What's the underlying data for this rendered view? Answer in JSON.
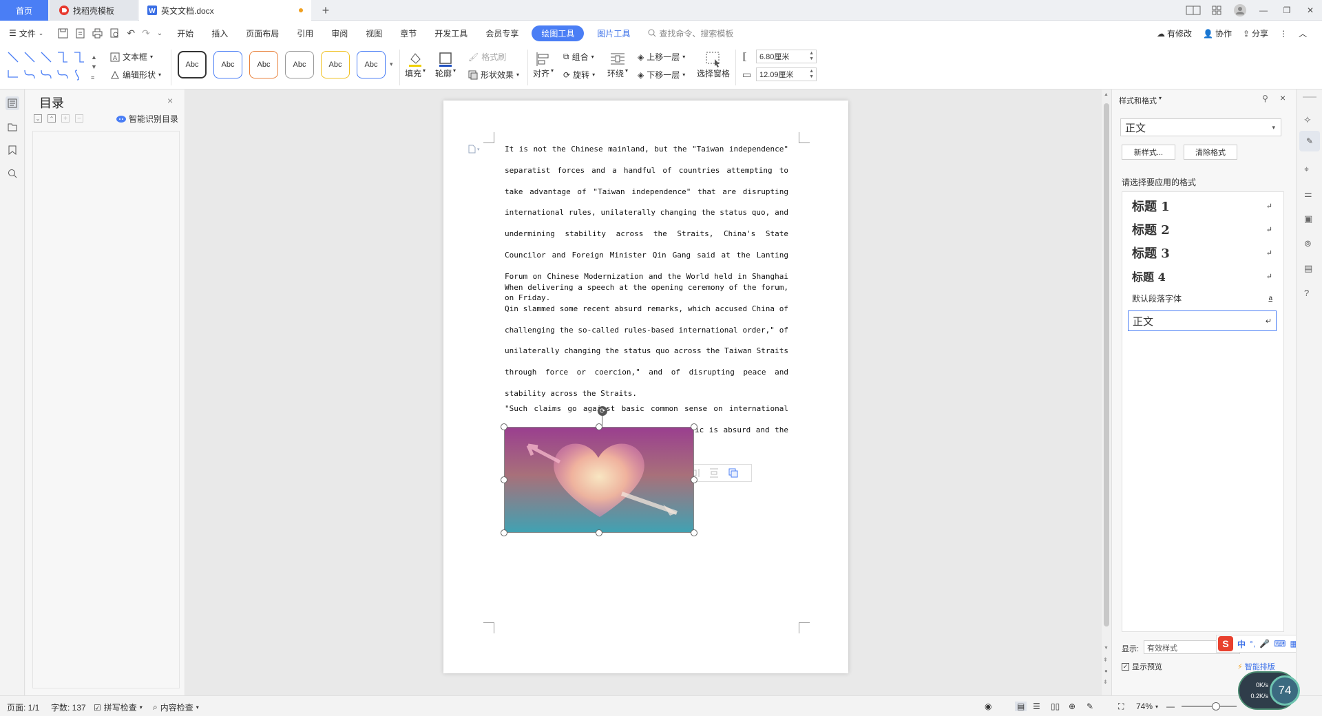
{
  "tabs": {
    "home": "首页",
    "template": "找稻壳模板",
    "doc": "英文文档.docx"
  },
  "menu": {
    "file": "文件",
    "items": [
      "开始",
      "插入",
      "页面布局",
      "引用",
      "审阅",
      "视图",
      "章节",
      "开发工具",
      "会员专享"
    ],
    "active": "绘图工具",
    "picture_tools": "图片工具",
    "search": "查找命令、搜索模板",
    "modify": "有修改",
    "collab": "协作",
    "share": "分享"
  },
  "ribbon": {
    "text_box": "文本框",
    "edit_shape": "编辑形状",
    "swatch_label": "Abc",
    "fill": "填充",
    "outline": "轮廓",
    "format_painter": "格式刷",
    "shape_effect": "形状效果",
    "align": "对齐",
    "group": "组合",
    "rotate": "旋转",
    "wrap": "环绕",
    "bring_forward": "上移一层",
    "send_backward": "下移一层",
    "selection_pane": "选择窗格",
    "height": "6.80厘米",
    "width": "12.09厘米"
  },
  "swatch_colors": [
    "#333333",
    "#4a7ef5",
    "#e8803a",
    "#999999",
    "#f0c020",
    "#4a7ef5"
  ],
  "nav": {
    "title": "目录",
    "smart": "智能识别目录"
  },
  "doc": {
    "paragraphs": [
      "It is not the Chinese mainland, but the \"Taiwan independence\" separatist forces and a handful of countries attempting to take advantage of \"Taiwan independence\" that are disrupting international rules, unilaterally changing the status quo, and undermining stability across the Straits, China's State Councilor and Foreign Minister Qin Gang said at the Lanting Forum on Chinese Modernization and the World held in Shanghai on Friday.",
      "When delivering a speech at the opening ceremony of the forum, Qin slammed some recent absurd remarks, which accused China of challenging the so-called rules-based international order,\" of unilaterally changing the status quo across the Taiwan Straits through force or coercion,\" and of disrupting peace and stability across the Straits.",
      "\"Such claims go against basic common sense on international relations and historical justice. The logic is absurd and the con"
    ]
  },
  "styles": {
    "title": "样式和格式",
    "current": "正文",
    "new_style": "新样式...",
    "clear_format": "清除格式",
    "prompt": "请选择要应用的格式",
    "list": [
      {
        "label": "标题 1",
        "kind": "heading"
      },
      {
        "label": "标题 2",
        "kind": "heading"
      },
      {
        "label": "标题 3",
        "kind": "heading"
      },
      {
        "label": "标题 4",
        "kind": "heading"
      },
      {
        "label": "默认段落字体",
        "kind": "char"
      },
      {
        "label": "正文",
        "kind": "body"
      }
    ],
    "show_label": "显示:",
    "show_value": "有效样式",
    "preview": "显示预览",
    "smart_layout": "智能排版"
  },
  "ime": {
    "lang": "中"
  },
  "status": {
    "page": "页面: 1/1",
    "words": "字数: 137",
    "spell": "拼写检查",
    "content": "内容检查",
    "zoom": "74%"
  },
  "speed": {
    "percent": "74",
    "up": "0K/s",
    "down": "0.2K/s"
  }
}
